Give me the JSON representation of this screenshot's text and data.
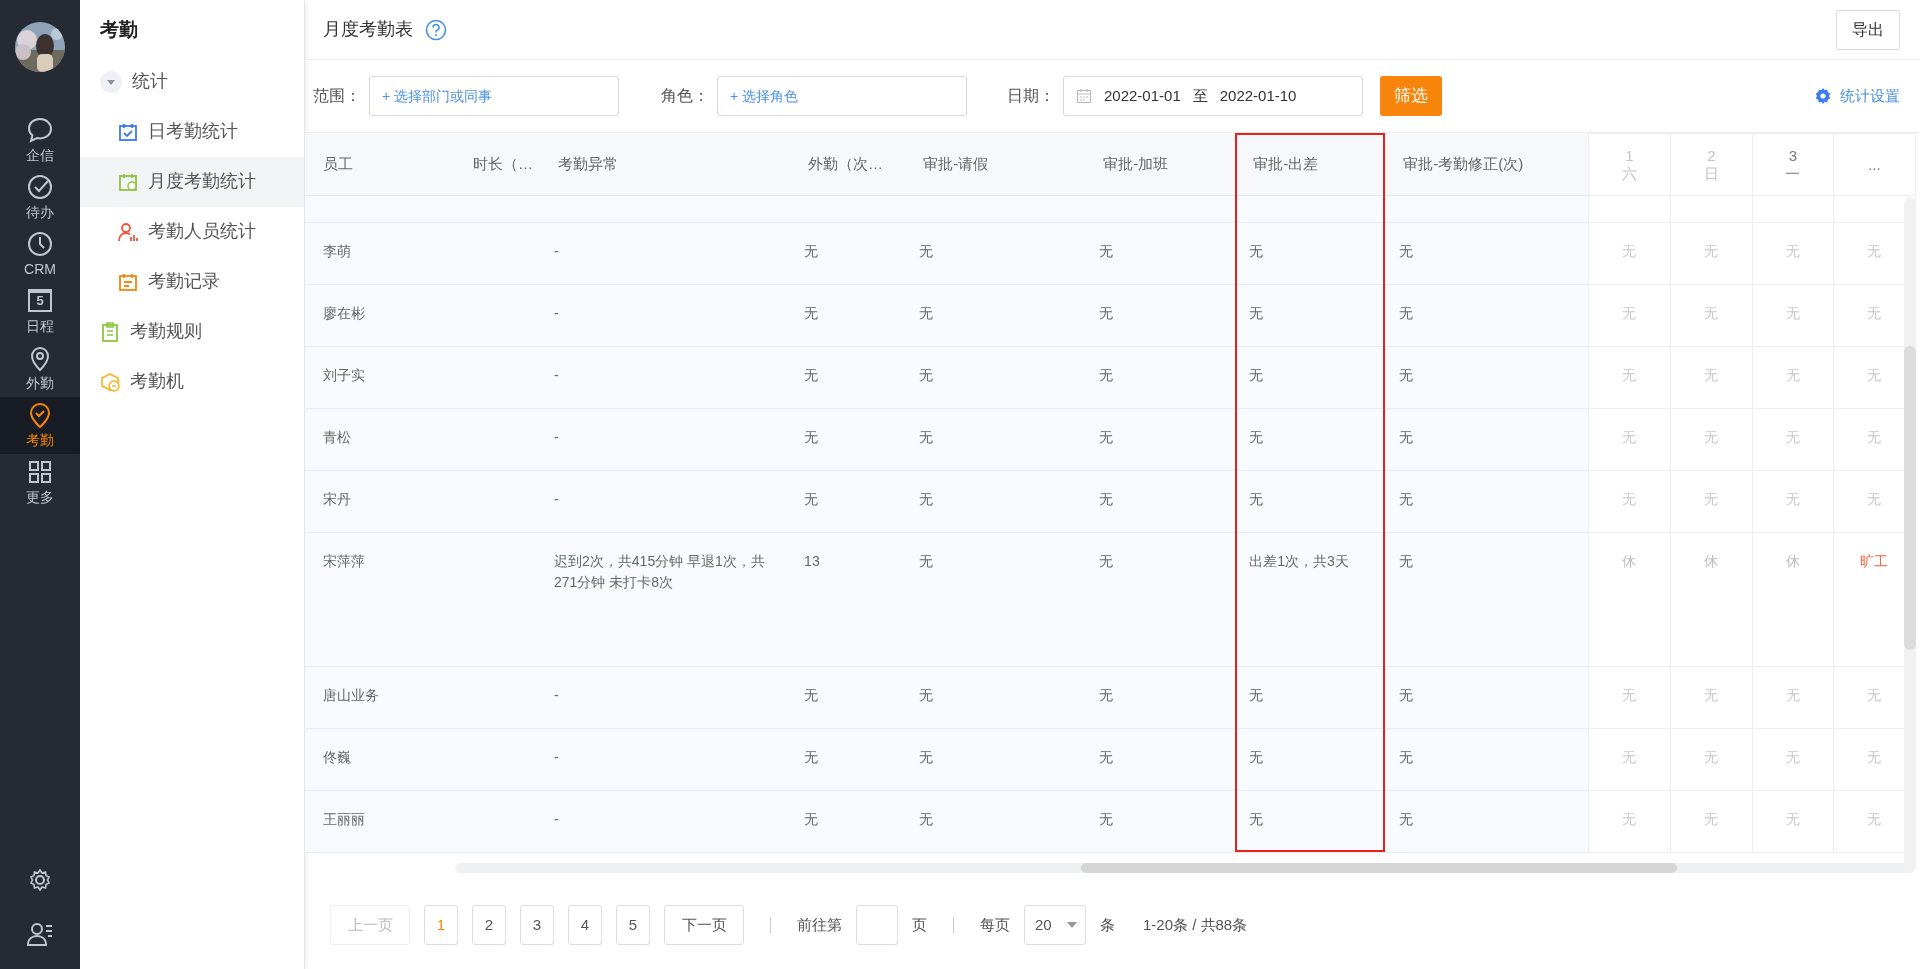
{
  "rail": {
    "items": [
      {
        "label": "企信",
        "selected": false
      },
      {
        "label": "待办",
        "selected": false
      },
      {
        "label": "CRM",
        "selected": false
      },
      {
        "label": "日程",
        "icon_text": "5",
        "selected": false
      },
      {
        "label": "外勤",
        "selected": false
      },
      {
        "label": "考勤",
        "selected": true
      },
      {
        "label": "更多",
        "selected": false
      }
    ]
  },
  "submenu": {
    "title": "考勤",
    "items": [
      {
        "label": "统计",
        "expanded": true,
        "children": [
          {
            "label": "日考勤统计",
            "selected": false
          },
          {
            "label": "月度考勤统计",
            "selected": true
          },
          {
            "label": "考勤人员统计",
            "selected": false
          },
          {
            "label": "考勤记录",
            "selected": false
          }
        ]
      },
      {
        "label": "考勤规则"
      },
      {
        "label": "考勤机"
      }
    ]
  },
  "header": {
    "title": "月度考勤表",
    "export_button": "导出"
  },
  "filters": {
    "scope_label": "范围：",
    "scope_placeholder": "+ 选择部门或同事",
    "role_label": "角色：",
    "role_placeholder": "+ 选择角色",
    "date_label": "日期：",
    "date_start": "2022-01-01",
    "date_separator": "至",
    "date_end": "2022-01-10",
    "filter_button": "筛选",
    "settings_link": "统计设置"
  },
  "table": {
    "columns": [
      {
        "label": "员工",
        "highlighted": false
      },
      {
        "label": "时长（…",
        "highlighted": false
      },
      {
        "label": "考勤异常",
        "highlighted": false
      },
      {
        "label": "外勤（次…",
        "highlighted": false
      },
      {
        "label": "审批-请假",
        "highlighted": false
      },
      {
        "label": "审批-加班",
        "highlighted": false
      },
      {
        "label": "审批-出差",
        "highlighted": true
      },
      {
        "label": "审批-考勤修正(次)",
        "highlighted": false
      }
    ],
    "days": [
      {
        "day": "1",
        "weekday": "六",
        "weekend": true
      },
      {
        "day": "2",
        "weekday": "日",
        "weekend": true
      },
      {
        "day": "3",
        "weekday": "一",
        "weekend": false
      }
    ],
    "more_label": "...",
    "rows": [
      {
        "kind": "plain",
        "name": "李萌",
        "anomaly": "-",
        "field": "无",
        "leave": "无",
        "overtime": "无",
        "trip": "无",
        "correction": "无",
        "days": [
          {
            "text": "无",
            "kind": "none"
          },
          {
            "text": "无",
            "kind": "none"
          },
          {
            "text": "无",
            "kind": "none"
          },
          {
            "text": "无",
            "kind": "none"
          }
        ]
      },
      {
        "kind": "plain",
        "name": "廖在彬",
        "anomaly": "-",
        "field": "无",
        "leave": "无",
        "overtime": "无",
        "trip": "无",
        "correction": "无",
        "days": [
          {
            "text": "无",
            "kind": "none"
          },
          {
            "text": "无",
            "kind": "none"
          },
          {
            "text": "无",
            "kind": "none"
          },
          {
            "text": "无",
            "kind": "none"
          }
        ]
      },
      {
        "kind": "plain",
        "name": "刘子实",
        "anomaly": "-",
        "field": "无",
        "leave": "无",
        "overtime": "无",
        "trip": "无",
        "correction": "无",
        "days": [
          {
            "text": "无",
            "kind": "none"
          },
          {
            "text": "无",
            "kind": "none"
          },
          {
            "text": "无",
            "kind": "none"
          },
          {
            "text": "无",
            "kind": "none"
          }
        ]
      },
      {
        "kind": "plain",
        "name": "青松",
        "anomaly": "-",
        "field": "无",
        "leave": "无",
        "overtime": "无",
        "trip": "无",
        "correction": "无",
        "days": [
          {
            "text": "无",
            "kind": "none"
          },
          {
            "text": "无",
            "kind": "none"
          },
          {
            "text": "无",
            "kind": "none"
          },
          {
            "text": "无",
            "kind": "none"
          }
        ]
      },
      {
        "kind": "plain",
        "name": "宋丹",
        "anomaly": "-",
        "field": "无",
        "leave": "无",
        "overtime": "无",
        "trip": "无",
        "correction": "无",
        "days": [
          {
            "text": "无",
            "kind": "none"
          },
          {
            "text": "无",
            "kind": "none"
          },
          {
            "text": "无",
            "kind": "none"
          },
          {
            "text": "无",
            "kind": "none"
          }
        ]
      },
      {
        "kind": "detail",
        "name": "宋萍萍",
        "anomaly": "迟到2次，共415分钟 早退1次，共271分钟 未打卡8次",
        "field": "13",
        "leave": "无",
        "overtime": "无",
        "trip": "出差1次，共3天",
        "correction": "无",
        "days": [
          {
            "text": "休",
            "kind": "rest"
          },
          {
            "text": "休",
            "kind": "rest"
          },
          {
            "text": "休",
            "kind": "rest"
          },
          {
            "text": "旷工",
            "kind": "absent"
          }
        ]
      },
      {
        "kind": "plain",
        "name": "唐山业务",
        "anomaly": "-",
        "field": "无",
        "leave": "无",
        "overtime": "无",
        "trip": "无",
        "correction": "无",
        "days": [
          {
            "text": "无",
            "kind": "none"
          },
          {
            "text": "无",
            "kind": "none"
          },
          {
            "text": "无",
            "kind": "none"
          },
          {
            "text": "无",
            "kind": "none"
          }
        ]
      },
      {
        "kind": "plain",
        "name": "佟巍",
        "anomaly": "-",
        "field": "无",
        "leave": "无",
        "overtime": "无",
        "trip": "无",
        "correction": "无",
        "days": [
          {
            "text": "无",
            "kind": "none"
          },
          {
            "text": "无",
            "kind": "none"
          },
          {
            "text": "无",
            "kind": "none"
          },
          {
            "text": "无",
            "kind": "none"
          }
        ]
      },
      {
        "kind": "plain",
        "name": "王丽丽",
        "anomaly": "-",
        "field": "无",
        "leave": "无",
        "overtime": "无",
        "trip": "无",
        "correction": "无",
        "days": [
          {
            "text": "无",
            "kind": "none"
          },
          {
            "text": "无",
            "kind": "none"
          },
          {
            "text": "无",
            "kind": "none"
          },
          {
            "text": "无",
            "kind": "none"
          }
        ]
      }
    ]
  },
  "pagination": {
    "prev": "上一页",
    "prev_disabled": true,
    "pages": [
      {
        "label": "1",
        "selected": true
      },
      {
        "label": "2",
        "selected": false
      },
      {
        "label": "3",
        "selected": false
      },
      {
        "label": "4",
        "selected": false
      },
      {
        "label": "5",
        "selected": false
      }
    ],
    "next": "下一页",
    "goto_label": "前往第",
    "goto_unit": "页",
    "per_page_label": "每页",
    "per_page": "20",
    "per_page_unit": "条",
    "summary": "1-20条 / 共88条"
  }
}
